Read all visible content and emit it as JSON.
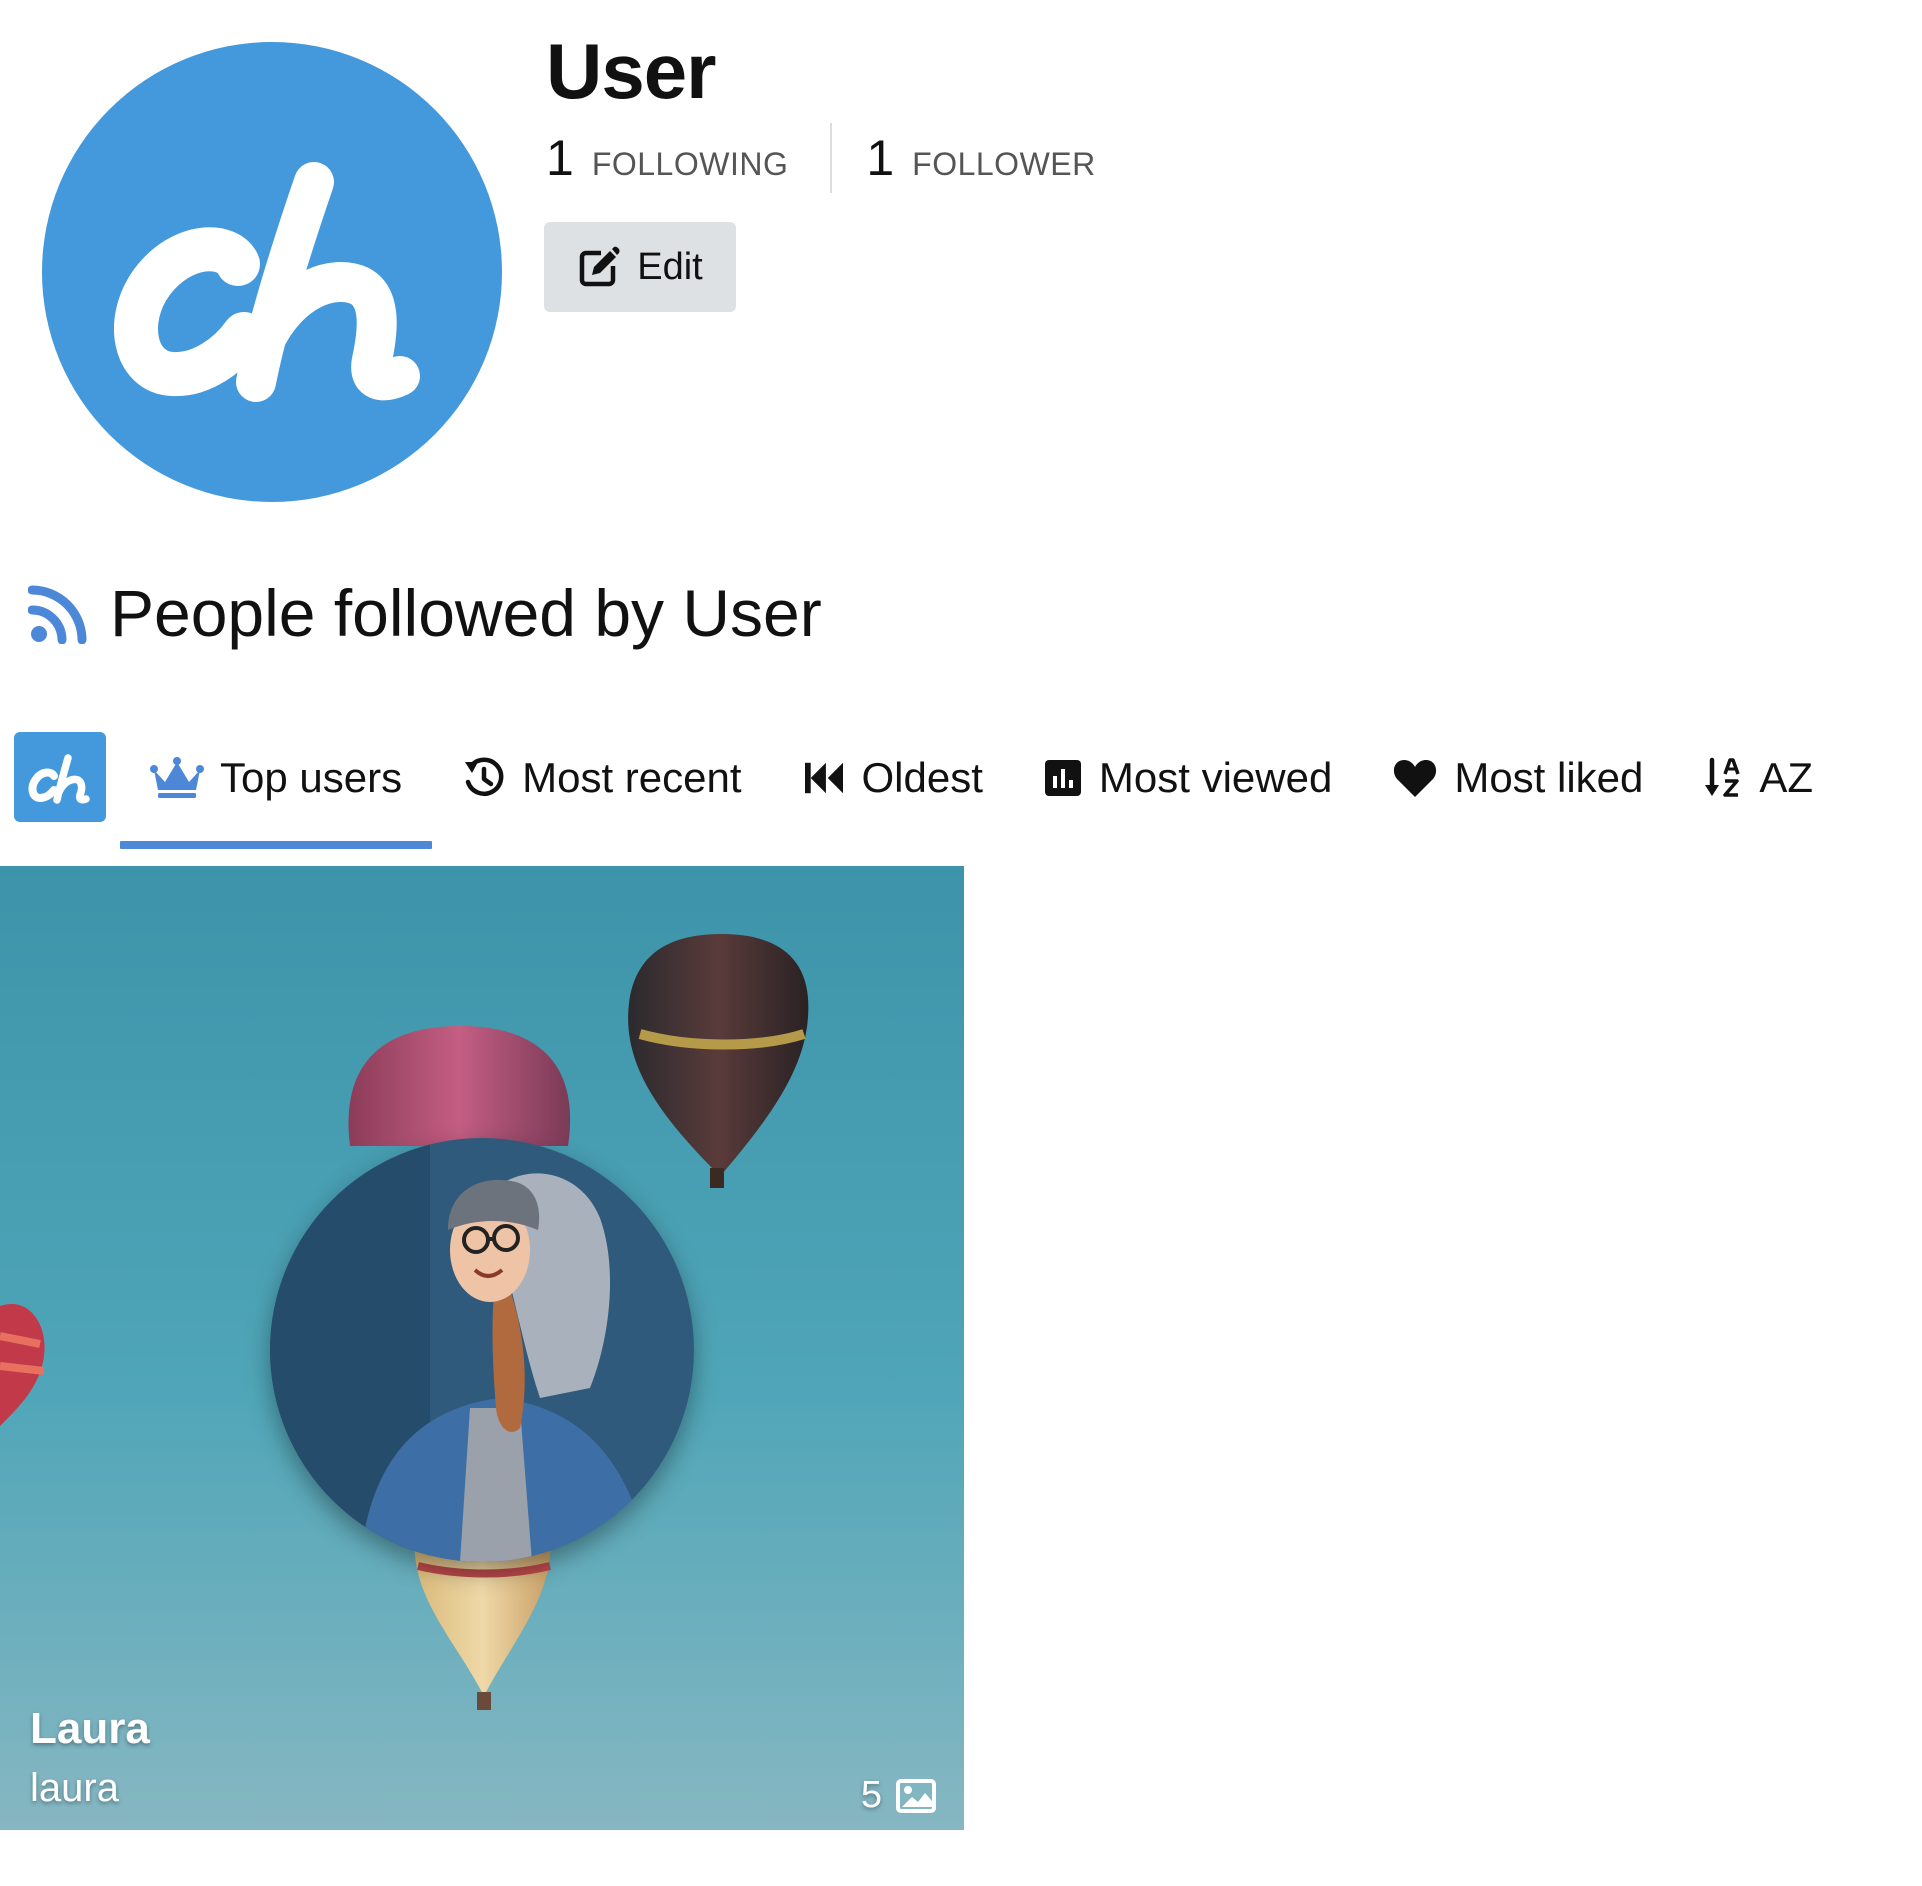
{
  "profile": {
    "name": "User",
    "logo_icon": "chevereto-ch-logo",
    "brand_color": "#4399dc",
    "following": {
      "count": "1",
      "label": "FOLLOWING"
    },
    "followers": {
      "count": "1",
      "label": "FOLLOWER"
    },
    "edit_label": "Edit"
  },
  "section": {
    "icon": "rss-icon",
    "icon_color": "#4d88d8",
    "title": "People followed by User"
  },
  "sort_tabs": {
    "active_color": "#4d88d8",
    "items": [
      {
        "icon": "crown-icon",
        "label": "Top users",
        "active": true
      },
      {
        "icon": "history-icon",
        "label": "Most recent",
        "active": false
      },
      {
        "icon": "backward-icon",
        "label": "Oldest",
        "active": false
      },
      {
        "icon": "bar-chart-icon",
        "label": "Most viewed",
        "active": false
      },
      {
        "icon": "heart-icon",
        "label": "Most liked",
        "active": false
      },
      {
        "icon": "sort-alpha-icon",
        "label": "AZ",
        "active": false
      }
    ]
  },
  "users": [
    {
      "name": "Laura",
      "username": "laura",
      "image_count": "5",
      "count_icon": "image-icon",
      "background": "hot-air-balloons",
      "avatar": "woman-in-hoodie"
    }
  ]
}
